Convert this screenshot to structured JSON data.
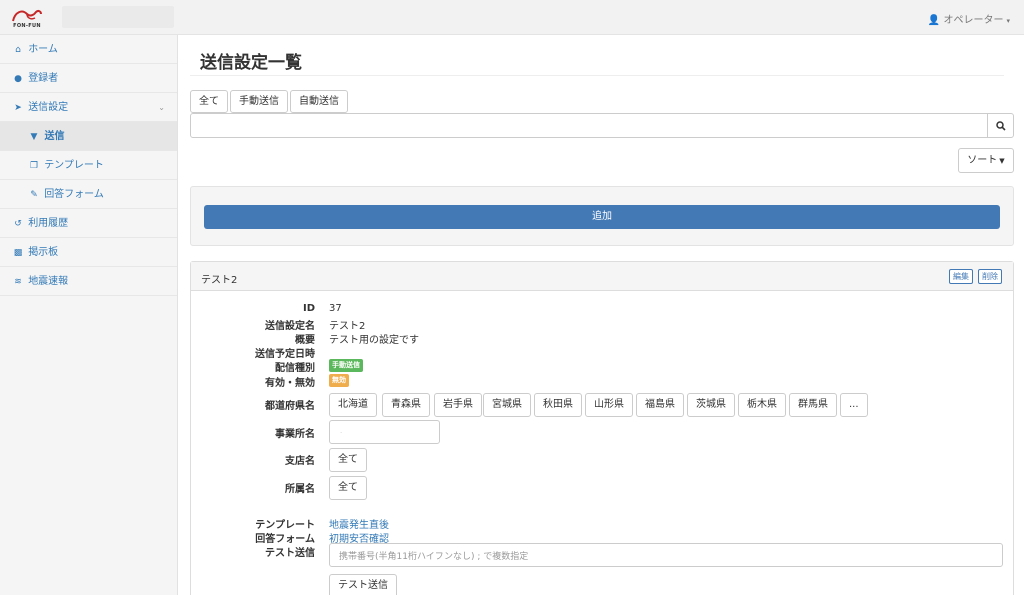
{
  "app": {
    "logo_text": "FON-FUN"
  },
  "header": {
    "user_label": "オペレーター",
    "user_caret": "▾"
  },
  "sidebar": {
    "items": [
      {
        "label": "ホーム",
        "icon": "home-icon"
      },
      {
        "label": "登録者",
        "icon": "user-icon"
      },
      {
        "label": "送信設定",
        "icon": "send-icon"
      },
      {
        "label": "送信",
        "icon": "filter-icon"
      },
      {
        "label": "テンプレート",
        "icon": "copy-icon"
      },
      {
        "label": "回答フォーム",
        "icon": "edit-icon"
      },
      {
        "label": "利用履歴",
        "icon": "history-icon"
      },
      {
        "label": "掲示板",
        "icon": "comments-icon"
      },
      {
        "label": "地震速報",
        "icon": "rss-icon"
      }
    ],
    "chevron": "⌄"
  },
  "main": {
    "title": "送信設定一覧",
    "filters": [
      "全て",
      "手動送信",
      "自動送信"
    ],
    "search_value": "",
    "sort_label": "ソート",
    "add_label": "追加"
  },
  "panel": {
    "title": "テスト2",
    "edit_label": "編集",
    "delete_label": "削除",
    "fields": {
      "id_label": "ID",
      "id_value": "37",
      "name_label": "送信設定名",
      "name_value": "テスト2",
      "summary_label": "概要",
      "summary_value": "テスト用の設定です",
      "schedule_label": "送信予定日時",
      "schedule_value": "",
      "type_label": "配信種別",
      "type_value": "手動送信",
      "enabled_label": "有効・無効",
      "enabled_value": "無効",
      "prefecture_label": "都道府県名",
      "prefectures": [
        "北海道",
        "青森県",
        "岩手県",
        "宮城県",
        "秋田県",
        "山形県",
        "福島県",
        "茨城県",
        "栃木県",
        "群馬県",
        "..."
      ],
      "office_label": "事業所名",
      "branch_label": "支店名",
      "branch_value": "全て",
      "dept_label": "所属名",
      "dept_value": "全て",
      "template_label": "テンプレート",
      "template_value": "地震発生直後",
      "form_label": "回答フォーム",
      "form_value": "初期安否確認",
      "test_label": "テスト送信",
      "test_placeholder": "携帯番号(半角11桁ハイフンなし) ; で複数指定",
      "test_button": "テスト送信"
    }
  },
  "colors": {
    "primary": "#4379b5",
    "link": "#337ab7",
    "badge_manual": "#5cb85c",
    "badge_disabled": "#f0ad4e"
  }
}
